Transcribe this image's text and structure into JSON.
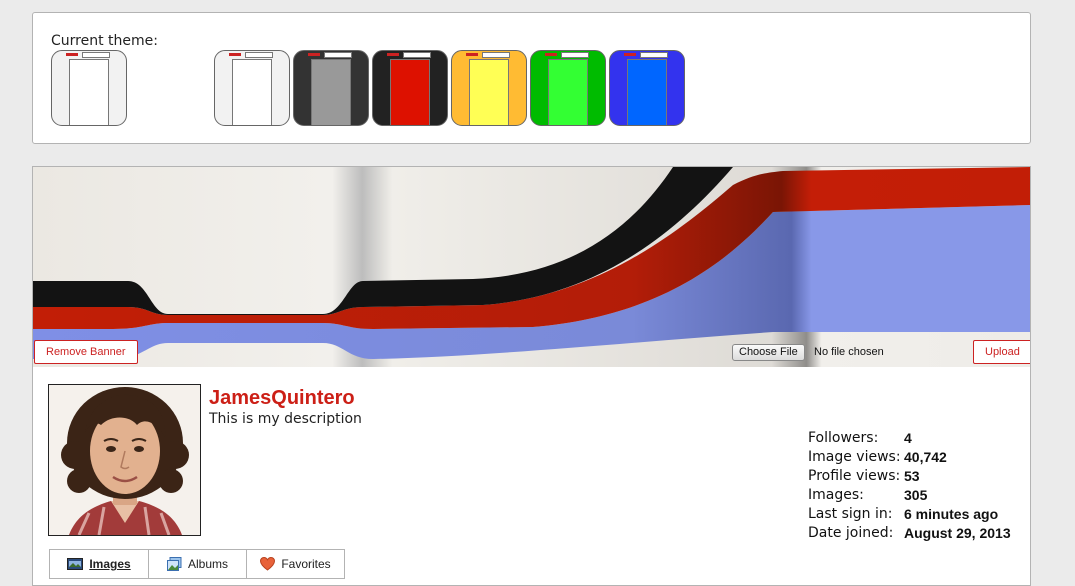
{
  "theme_selector": {
    "label": "Current theme:",
    "current": {
      "frame": "#f2f2f2",
      "body": "#ffffff"
    },
    "options": [
      {
        "name": "light",
        "frame": "#f2f2f2",
        "body": "#ffffff"
      },
      {
        "name": "dark-gray",
        "frame": "#333333",
        "body": "#999999"
      },
      {
        "name": "red",
        "frame": "#222222",
        "body": "#dd1100"
      },
      {
        "name": "yellow",
        "frame": "#ffbb33",
        "body": "#ffff55"
      },
      {
        "name": "green",
        "frame": "#00bb00",
        "body": "#33ff33"
      },
      {
        "name": "blue",
        "frame": "#3333ee",
        "body": "#0066ff"
      }
    ]
  },
  "banner": {
    "remove_label": "Remove Banner",
    "choose_file_label": "Choose File",
    "file_status": "No file chosen",
    "upload_label": "Upload"
  },
  "profile": {
    "username": "JamesQuintero",
    "description": "This is my description",
    "accent": "#cc1f16"
  },
  "stats": [
    {
      "label": "Followers:",
      "value": "4"
    },
    {
      "label": "Image views:",
      "value": "40,742"
    },
    {
      "label": "Profile views:",
      "value": "53"
    },
    {
      "label": "Images:",
      "value": "305"
    },
    {
      "label": "Last sign in:",
      "value": "6 minutes ago"
    },
    {
      "label": "Date joined:",
      "value": "August 29, 2013"
    }
  ],
  "tabs": [
    {
      "label": "Images",
      "icon": "images-icon",
      "active": true
    },
    {
      "label": "Albums",
      "icon": "albums-icon",
      "active": false
    },
    {
      "label": "Favorites",
      "icon": "heart-icon",
      "active": false
    }
  ]
}
